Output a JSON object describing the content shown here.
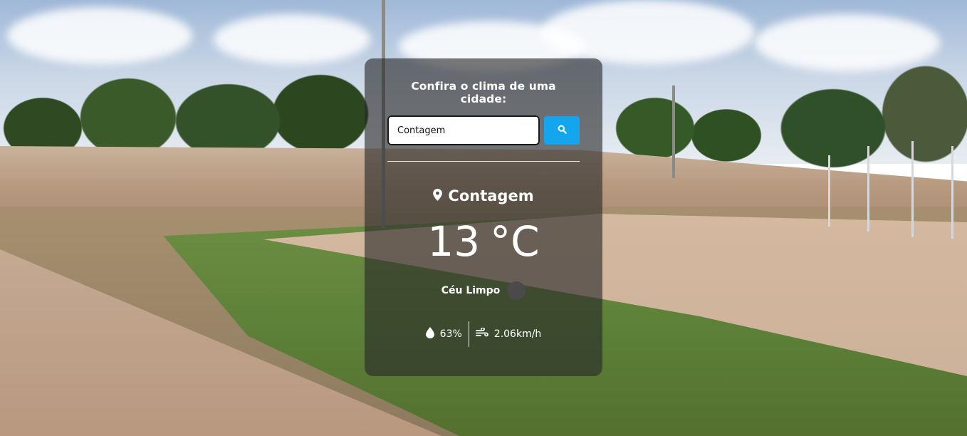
{
  "form": {
    "title": "Confira o clima de uma cidade:",
    "input_value": "Contagem",
    "search_icon": "search-icon"
  },
  "weather": {
    "city": "Contagem",
    "location_icon": "map-pin-icon",
    "temperature": "13",
    "unit": "°C",
    "description": "Céu Limpo",
    "description_icon": "weather-condition-icon",
    "humidity": "63%",
    "humidity_icon": "droplet-icon",
    "wind": "2.06km/h",
    "wind_icon": "wind-icon"
  },
  "colors": {
    "search_button": "#14a5ef",
    "card_background": "rgba(40,40,40,0.62)"
  }
}
